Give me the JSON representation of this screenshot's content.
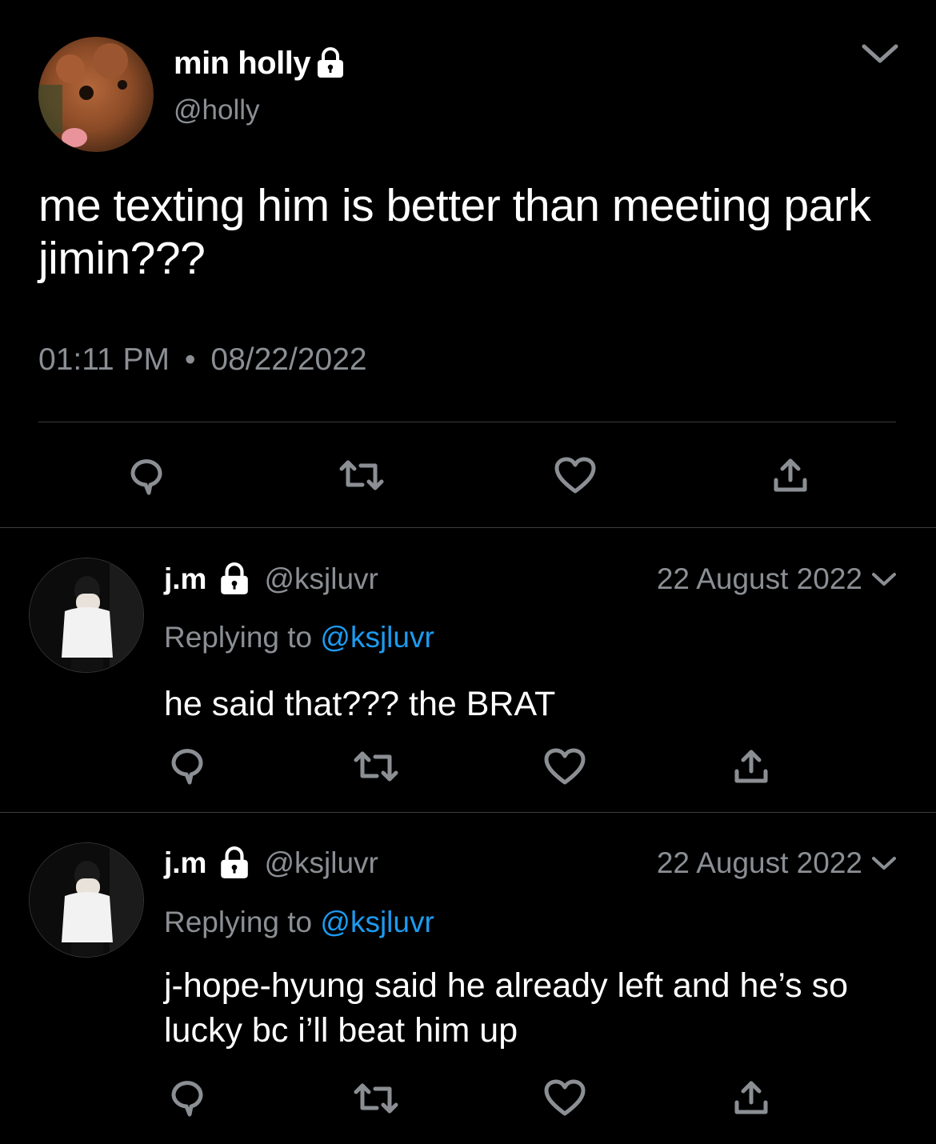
{
  "main_tweet": {
    "author_name": "min holly",
    "author_handle": "@holly",
    "text": "me texting him is better than meeting park jimin???",
    "time": "01:11 PM",
    "separator": "•",
    "date": "08/22/2022"
  },
  "replies": [
    {
      "author_name": "j.m",
      "author_handle": "@ksjluvr",
      "date": "22 August 2022",
      "replying_prefix": "Replying to",
      "replying_to": "@ksjluvr",
      "text": "he said that??? the BRAT"
    },
    {
      "author_name": "j.m",
      "author_handle": "@ksjluvr",
      "date": "22 August 2022",
      "replying_prefix": "Replying to",
      "replying_to": "@ksjluvr",
      "text": "j-hope-hyung said he already left and he’s so lucky bc i’ll beat him up"
    }
  ],
  "icons": {
    "lock": "lock-icon",
    "chevron": "chevron-down-icon",
    "reply": "reply-icon",
    "retweet": "retweet-icon",
    "like": "heart-icon",
    "share": "share-icon"
  },
  "colors": {
    "background": "#000000",
    "text": "#ffffff",
    "secondary": "#8b8f94",
    "link": "#1d9bf0"
  }
}
